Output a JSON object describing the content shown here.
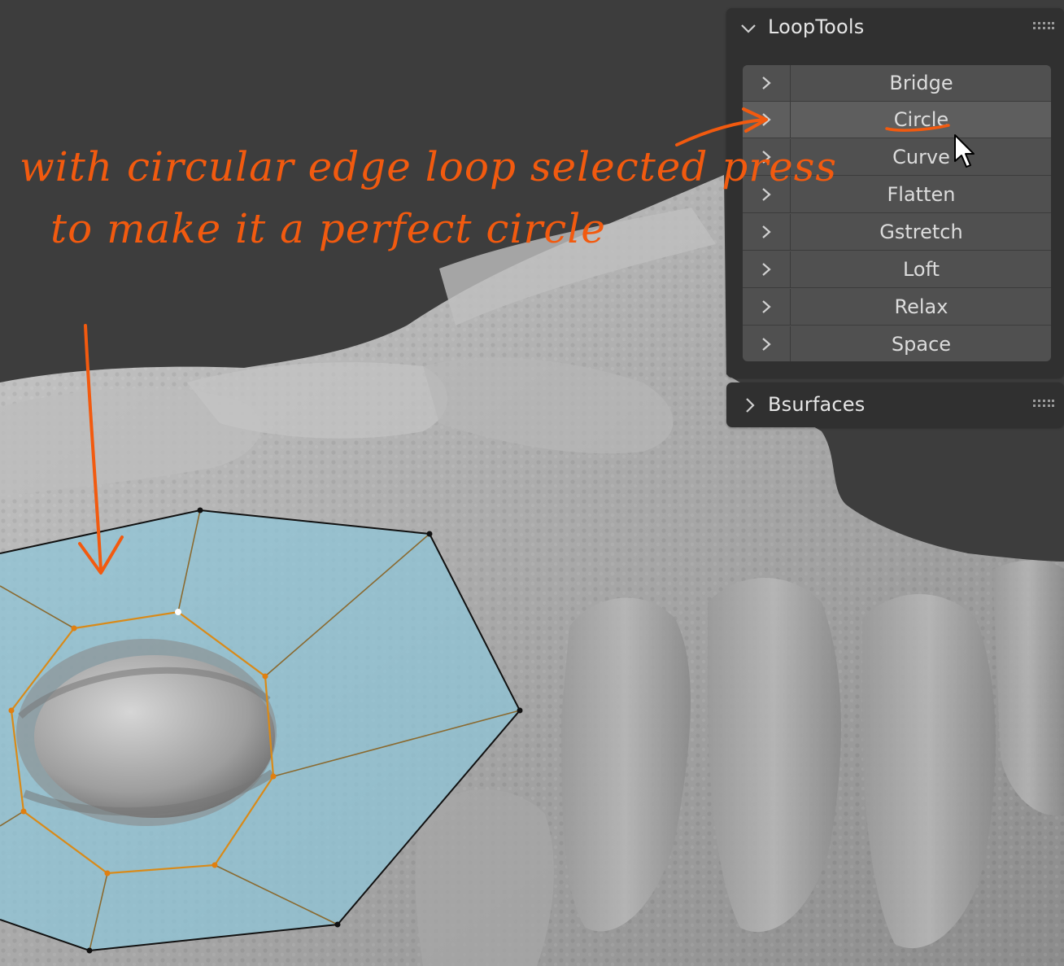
{
  "looptools": {
    "title": "LoopTools",
    "items": [
      {
        "label": "Bridge"
      },
      {
        "label": "Circle"
      },
      {
        "label": "Curve"
      },
      {
        "label": "Flatten"
      },
      {
        "label": "Gstretch"
      },
      {
        "label": "Loft"
      },
      {
        "label": "Relax"
      },
      {
        "label": "Space"
      }
    ],
    "hovered_item": "Circle"
  },
  "bsurfaces": {
    "title": "Bsurfaces"
  },
  "annotation": {
    "line1": "with circular edge loop selected press",
    "line2": "to make it a perfect circle",
    "color": "#f25a0f"
  },
  "icons": {
    "panel_expanded": "chevron-down-icon",
    "panel_collapsed": "chevron-right-icon",
    "item_expander": "chevron-right-icon",
    "drag_handle": "grip-dots-icon",
    "cursor": "mouse-pointer-icon"
  },
  "colors": {
    "background": "#3d3d3d",
    "panel": "#303030",
    "list": "#505050",
    "hover": "#5e5e5e",
    "mesh_face": "#8fc6d8",
    "selected_edge": "#d98a18"
  }
}
